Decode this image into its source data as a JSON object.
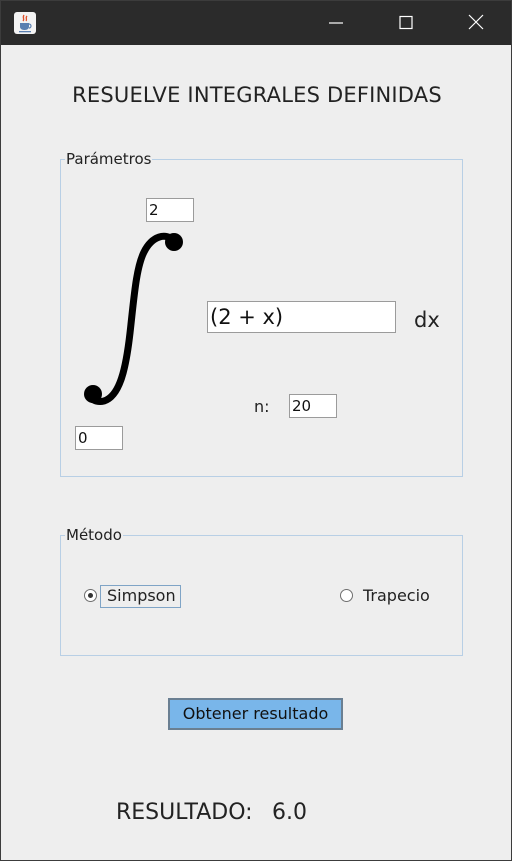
{
  "window": {
    "icon": "java-cup-icon",
    "controls": [
      "minimize-icon",
      "maximize-icon",
      "close-icon"
    ],
    "titlebar_color": "#2b2b2b"
  },
  "header": {
    "title": "RESUELVE INTEGRALES DEFINIDAS"
  },
  "parametros": {
    "legend": "Parámetros",
    "upper_limit": "2",
    "lower_limit": "0",
    "function": "(2 + x)",
    "dx_label": "dx",
    "n_label": "n:",
    "n_value": "20",
    "integral_symbol": "integral-sign-icon"
  },
  "metodo": {
    "legend": "Método",
    "options": [
      {
        "label": "Simpson",
        "selected": true
      },
      {
        "label": "Trapecio",
        "selected": false
      }
    ]
  },
  "action": {
    "label": "Obtener resultado",
    "color": "#79b6ea"
  },
  "result": {
    "label": "RESULTADO:",
    "value": "6.0"
  },
  "colors": {
    "group_border": "#b8cfe5",
    "background": "#eeeeee"
  }
}
